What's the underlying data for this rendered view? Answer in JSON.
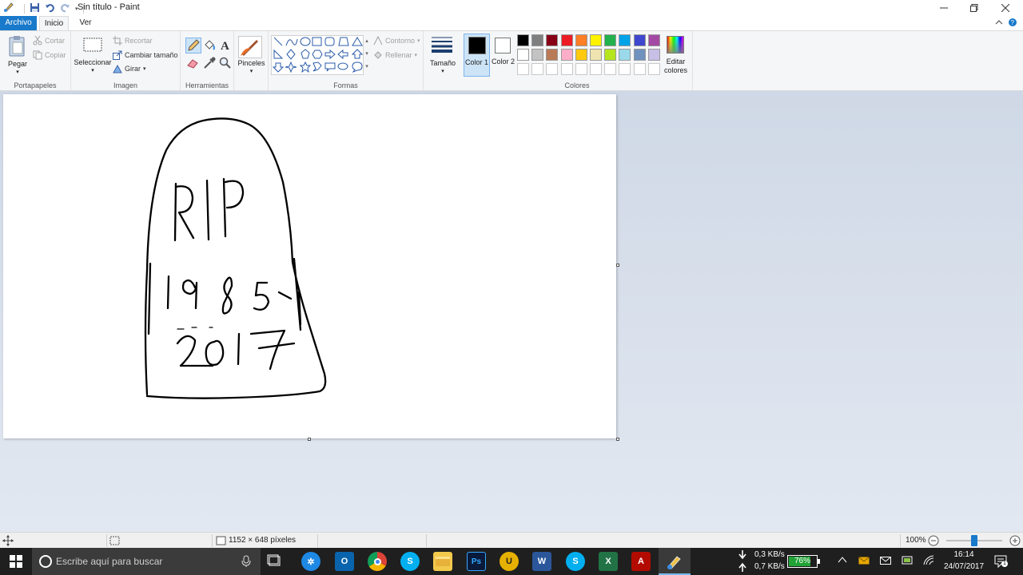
{
  "window": {
    "title": "Sin título - Paint"
  },
  "tabs": [
    {
      "label": "Archivo"
    },
    {
      "label": "Inicio"
    },
    {
      "label": "Ver"
    }
  ],
  "ribbon": {
    "portapapeles": {
      "label": "Portapapeles",
      "pegar": "Pegar",
      "cortar": "Cortar",
      "copiar": "Copiar"
    },
    "imagen": {
      "label": "Imagen",
      "seleccionar": "Seleccionar",
      "recortar": "Recortar",
      "cambiar_tamano": "Cambiar tamaño",
      "girar": "Girar"
    },
    "herramientas": {
      "label": "Herramientas"
    },
    "pinceles": {
      "label": "Pinceles"
    },
    "formas": {
      "label": "Formas",
      "contorno": "Contorno",
      "rellenar": "Rellenar"
    },
    "tamano": {
      "label": "Tamaño"
    },
    "colores": {
      "label": "Colores",
      "color1_label": "Color 1",
      "color2_label": "Color 2",
      "editar_label": "Editar colores",
      "color1": "#000000",
      "color2": "#ffffff",
      "palette_row1": [
        "#000000",
        "#7f7f7f",
        "#880015",
        "#ed1c24",
        "#ff7f27",
        "#fff200",
        "#22b14c",
        "#00a2e8",
        "#3f48cc",
        "#a349a4"
      ],
      "palette_row2": [
        "#ffffff",
        "#c3c3c3",
        "#b97a57",
        "#ffaec9",
        "#ffc90e",
        "#efe4b0",
        "#b5e61d",
        "#99d9ea",
        "#7092be",
        "#c8bfe7"
      ]
    }
  },
  "status": {
    "dimensions": "1152 × 648 píxeles",
    "zoom": "100%",
    "zoom_level": 0.5
  },
  "taskbar": {
    "search_placeholder": "Escribe aquí para buscar",
    "net_down": "0,3 KB/s",
    "net_up": "0,7 KB/s",
    "battery": "76%",
    "battery_level": 0.76,
    "time": "16:14",
    "date": "24/07/2017"
  }
}
